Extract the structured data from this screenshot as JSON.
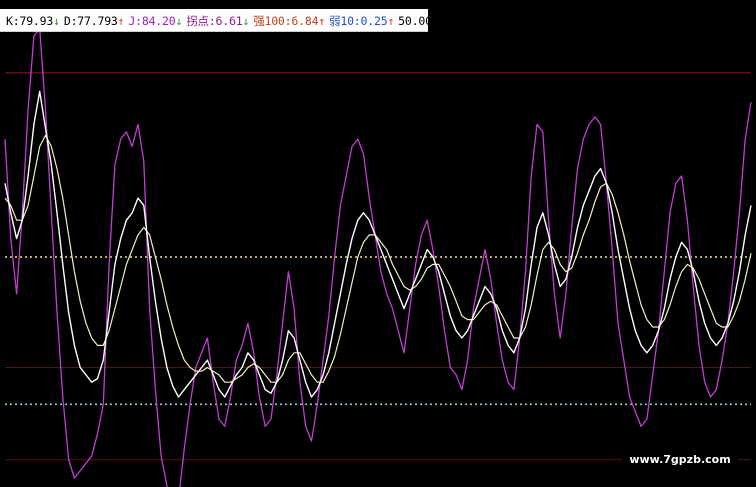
{
  "header": {
    "items": [
      {
        "label": "K",
        "value": "79.93",
        "arrow": "↓",
        "color": "#000000",
        "arrow_color": "#2f9a2f"
      },
      {
        "label": "D",
        "value": "77.793",
        "arrow": "↑",
        "color": "#000000",
        "arrow_color": "#d33a1a"
      },
      {
        "label": "J",
        "value": "84.20",
        "arrow": "↓",
        "color": "#a020c0",
        "arrow_color": "#2f9a2f"
      },
      {
        "label": "拐点",
        "value": "6.61",
        "arrow": "↓",
        "color": "#8a1a8a",
        "arrow_color": "#2f9a2f"
      },
      {
        "label": "强100",
        "value": "6.84",
        "arrow": "↑",
        "color": "#c04020",
        "arrow_color": "#d33a1a"
      },
      {
        "label": "弱10",
        "value": "0.25",
        "arrow": "↑",
        "color": "#2050c0",
        "arrow_color": "#d33a1a"
      },
      {
        "label": "",
        "value": "50.000",
        "arrow": "",
        "color": "#000000",
        "arrow_color": "#000000"
      }
    ]
  },
  "watermark": "www.7gpzb.com",
  "colors": {
    "background": "#000000",
    "k_line": "#ffffff",
    "d_line": "#f2f0c0",
    "j_line": "#c040d0",
    "strong_line": "#8b1a1a",
    "mid_line": "#f0e08a",
    "weak_line": "#7fd0d0"
  },
  "chart_data": {
    "type": "line",
    "ylim": [
      -10,
      110
    ],
    "reference_lines": [
      {
        "name": "强100",
        "value": 100,
        "style": "solid",
        "color": "#8b1a1a"
      },
      {
        "name": "",
        "value": 50,
        "style": "dotted",
        "color": "#f0e08a"
      },
      {
        "name": "弱10",
        "value": 10,
        "style": "dotted",
        "color": "#7fd0d0"
      },
      {
        "name": "",
        "value": 20,
        "style": "solid",
        "color": "#5a1010"
      },
      {
        "name": "",
        "value": -5,
        "style": "solid",
        "color": "#5a1010"
      }
    ],
    "x": [
      0,
      1,
      2,
      3,
      4,
      5,
      6,
      7,
      8,
      9,
      10,
      11,
      12,
      13,
      14,
      15,
      16,
      17,
      18,
      19,
      20,
      21,
      22,
      23,
      24,
      25,
      26,
      27,
      28,
      29,
      30,
      31,
      32,
      33,
      34,
      35,
      36,
      37,
      38,
      39,
      40,
      41,
      42,
      43,
      44,
      45,
      46,
      47,
      48,
      49,
      50,
      51,
      52,
      53,
      54,
      55,
      56,
      57,
      58,
      59,
      60,
      61,
      62,
      63,
      64,
      65,
      66,
      67,
      68,
      69,
      70,
      71,
      72,
      73,
      74,
      75,
      76,
      77,
      78,
      79,
      80,
      81,
      82,
      83,
      84,
      85,
      86,
      87,
      88,
      89,
      90,
      91,
      92,
      93,
      94,
      95,
      96,
      97,
      98,
      99,
      100,
      101,
      102,
      103,
      104,
      105,
      106,
      107,
      108,
      109,
      110,
      111,
      112,
      113,
      114,
      115,
      116,
      117,
      118,
      119,
      120,
      121,
      122,
      123,
      124,
      125,
      126,
      127,
      128,
      129
    ],
    "series": [
      {
        "name": "K",
        "values": [
          70,
          62,
          55,
          60,
          72,
          86,
          95,
          85,
          75,
          62,
          48,
          35,
          26,
          20,
          18,
          16,
          17,
          22,
          35,
          48,
          55,
          60,
          62,
          66,
          64,
          50,
          38,
          28,
          20,
          15,
          12,
          14,
          16,
          18,
          20,
          22,
          18,
          14,
          12,
          15,
          18,
          20,
          24,
          22,
          18,
          14,
          13,
          16,
          22,
          30,
          28,
          22,
          16,
          12,
          14,
          18,
          24,
          32,
          40,
          48,
          55,
          60,
          62,
          60,
          56,
          52,
          48,
          44,
          40,
          36,
          40,
          44,
          48,
          52,
          50,
          46,
          40,
          34,
          30,
          28,
          30,
          34,
          38,
          42,
          40,
          36,
          30,
          26,
          24,
          28,
          36,
          48,
          58,
          62,
          56,
          48,
          42,
          44,
          50,
          58,
          64,
          68,
          72,
          74,
          70,
          62,
          52,
          44,
          36,
          30,
          26,
          24,
          26,
          30,
          36,
          44,
          50,
          54,
          52,
          46,
          38,
          32,
          28,
          26,
          28,
          32,
          38,
          46,
          56,
          64
        ]
      },
      {
        "name": "D",
        "values": [
          66,
          64,
          60,
          60,
          64,
          72,
          80,
          83,
          80,
          74,
          66,
          56,
          46,
          38,
          32,
          28,
          26,
          26,
          30,
          36,
          42,
          48,
          52,
          56,
          58,
          56,
          50,
          44,
          37,
          31,
          26,
          22,
          20,
          19,
          19,
          20,
          19,
          18,
          16,
          16,
          17,
          18,
          20,
          21,
          20,
          18,
          16,
          16,
          18,
          22,
          24,
          24,
          21,
          18,
          16,
          16,
          19,
          23,
          29,
          36,
          43,
          50,
          54,
          56,
          56,
          54,
          52,
          48,
          45,
          42,
          41,
          42,
          44,
          47,
          48,
          48,
          45,
          42,
          38,
          34,
          33,
          33,
          35,
          37,
          38,
          37,
          34,
          31,
          28,
          28,
          31,
          37,
          45,
          52,
          54,
          52,
          48,
          46,
          47,
          51,
          56,
          60,
          65,
          69,
          70,
          67,
          62,
          56,
          49,
          43,
          37,
          33,
          31,
          31,
          33,
          37,
          42,
          46,
          48,
          47,
          44,
          40,
          36,
          32,
          31,
          31,
          34,
          38,
          44,
          51
        ]
      },
      {
        "name": "J",
        "values": [
          82,
          55,
          40,
          62,
          90,
          110,
          112,
          90,
          62,
          35,
          12,
          -5,
          -10,
          -8,
          -6,
          -4,
          2,
          10,
          48,
          75,
          82,
          84,
          80,
          86,
          76,
          36,
          14,
          -4,
          -12,
          -18,
          -16,
          -2,
          10,
          20,
          24,
          28,
          16,
          6,
          4,
          12,
          22,
          26,
          32,
          24,
          12,
          4,
          6,
          18,
          32,
          46,
          36,
          16,
          4,
          0,
          10,
          22,
          34,
          50,
          64,
          72,
          80,
          82,
          78,
          66,
          56,
          46,
          40,
          36,
          30,
          24,
          36,
          48,
          56,
          60,
          52,
          42,
          30,
          20,
          18,
          14,
          22,
          36,
          44,
          52,
          44,
          32,
          22,
          16,
          14,
          28,
          46,
          72,
          86,
          84,
          60,
          40,
          28,
          40,
          58,
          74,
          82,
          86,
          88,
          86,
          70,
          52,
          32,
          22,
          12,
          8,
          4,
          6,
          18,
          30,
          46,
          62,
          70,
          72,
          60,
          42,
          26,
          16,
          12,
          14,
          22,
          32,
          46,
          62,
          82,
          92
        ]
      }
    ]
  }
}
